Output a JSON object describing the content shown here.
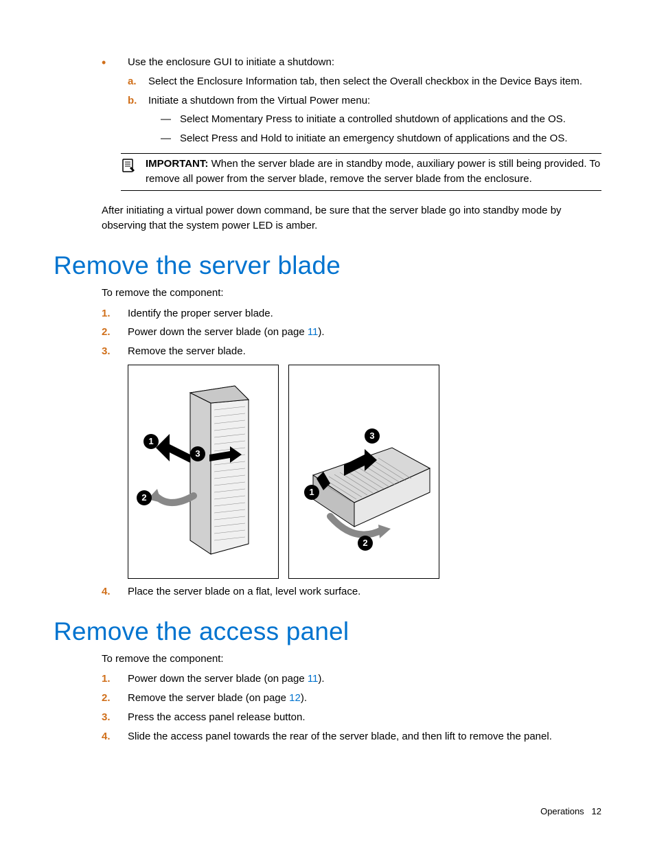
{
  "top_bullet": "Use the enclosure GUI to initiate a shutdown:",
  "alpha": {
    "a": "Select the Enclosure Information tab, then select the Overall checkbox in the Device Bays item.",
    "b": "Initiate a shutdown from the Virtual Power menu:"
  },
  "dashes": [
    "Select Momentary Press to initiate a controlled shutdown of applications and the OS.",
    "Select Press and Hold to initiate an emergency shutdown of applications and the OS."
  ],
  "important_label": "IMPORTANT:",
  "important_text": "When the server blade are in standby mode, auxiliary power is still being provided. To remove all power from the server blade, remove the server blade from the enclosure.",
  "after_para": "After initiating a virtual power down command, be sure that the server blade go into standby mode by observing that the system power LED is amber.",
  "h_remove_blade": "Remove the server blade",
  "remove_blade_intro": "To remove the component:",
  "remove_blade_steps": {
    "s1": "Identify the proper server blade.",
    "s2_a": "Power down the server blade (on page ",
    "s2_link": "11",
    "s2_b": ").",
    "s3": "Remove the server blade.",
    "s4": "Place the server blade on a flat, level work surface."
  },
  "h_remove_panel": "Remove the access panel",
  "remove_panel_intro": "To remove the component:",
  "remove_panel_steps": {
    "s1_a": "Power down the server blade (on page ",
    "s1_link": "11",
    "s1_b": ").",
    "s2_a": "Remove the server blade (on page ",
    "s2_link": "12",
    "s2_b": ").",
    "s3": "Press the access panel release button.",
    "s4": "Slide the access panel towards the rear of the server blade, and then lift to remove the panel."
  },
  "footer_section": "Operations",
  "footer_page": "12",
  "callouts": {
    "c1": "1",
    "c2": "2",
    "c3": "3"
  }
}
